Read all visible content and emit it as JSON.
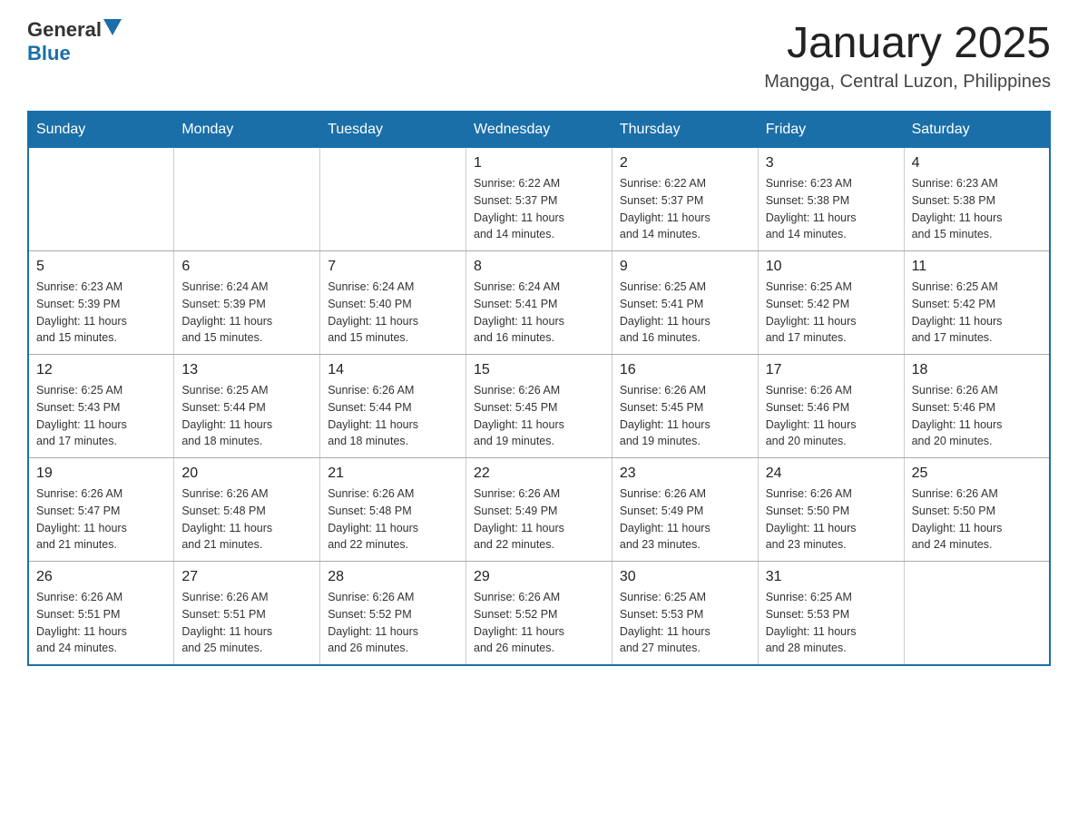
{
  "header": {
    "logo_general": "General",
    "logo_blue": "Blue",
    "month_title": "January 2025",
    "location": "Mangga, Central Luzon, Philippines"
  },
  "days_of_week": [
    "Sunday",
    "Monday",
    "Tuesday",
    "Wednesday",
    "Thursday",
    "Friday",
    "Saturday"
  ],
  "weeks": [
    [
      {
        "day": "",
        "info": ""
      },
      {
        "day": "",
        "info": ""
      },
      {
        "day": "",
        "info": ""
      },
      {
        "day": "1",
        "info": "Sunrise: 6:22 AM\nSunset: 5:37 PM\nDaylight: 11 hours\nand 14 minutes."
      },
      {
        "day": "2",
        "info": "Sunrise: 6:22 AM\nSunset: 5:37 PM\nDaylight: 11 hours\nand 14 minutes."
      },
      {
        "day": "3",
        "info": "Sunrise: 6:23 AM\nSunset: 5:38 PM\nDaylight: 11 hours\nand 14 minutes."
      },
      {
        "day": "4",
        "info": "Sunrise: 6:23 AM\nSunset: 5:38 PM\nDaylight: 11 hours\nand 15 minutes."
      }
    ],
    [
      {
        "day": "5",
        "info": "Sunrise: 6:23 AM\nSunset: 5:39 PM\nDaylight: 11 hours\nand 15 minutes."
      },
      {
        "day": "6",
        "info": "Sunrise: 6:24 AM\nSunset: 5:39 PM\nDaylight: 11 hours\nand 15 minutes."
      },
      {
        "day": "7",
        "info": "Sunrise: 6:24 AM\nSunset: 5:40 PM\nDaylight: 11 hours\nand 15 minutes."
      },
      {
        "day": "8",
        "info": "Sunrise: 6:24 AM\nSunset: 5:41 PM\nDaylight: 11 hours\nand 16 minutes."
      },
      {
        "day": "9",
        "info": "Sunrise: 6:25 AM\nSunset: 5:41 PM\nDaylight: 11 hours\nand 16 minutes."
      },
      {
        "day": "10",
        "info": "Sunrise: 6:25 AM\nSunset: 5:42 PM\nDaylight: 11 hours\nand 17 minutes."
      },
      {
        "day": "11",
        "info": "Sunrise: 6:25 AM\nSunset: 5:42 PM\nDaylight: 11 hours\nand 17 minutes."
      }
    ],
    [
      {
        "day": "12",
        "info": "Sunrise: 6:25 AM\nSunset: 5:43 PM\nDaylight: 11 hours\nand 17 minutes."
      },
      {
        "day": "13",
        "info": "Sunrise: 6:25 AM\nSunset: 5:44 PM\nDaylight: 11 hours\nand 18 minutes."
      },
      {
        "day": "14",
        "info": "Sunrise: 6:26 AM\nSunset: 5:44 PM\nDaylight: 11 hours\nand 18 minutes."
      },
      {
        "day": "15",
        "info": "Sunrise: 6:26 AM\nSunset: 5:45 PM\nDaylight: 11 hours\nand 19 minutes."
      },
      {
        "day": "16",
        "info": "Sunrise: 6:26 AM\nSunset: 5:45 PM\nDaylight: 11 hours\nand 19 minutes."
      },
      {
        "day": "17",
        "info": "Sunrise: 6:26 AM\nSunset: 5:46 PM\nDaylight: 11 hours\nand 20 minutes."
      },
      {
        "day": "18",
        "info": "Sunrise: 6:26 AM\nSunset: 5:46 PM\nDaylight: 11 hours\nand 20 minutes."
      }
    ],
    [
      {
        "day": "19",
        "info": "Sunrise: 6:26 AM\nSunset: 5:47 PM\nDaylight: 11 hours\nand 21 minutes."
      },
      {
        "day": "20",
        "info": "Sunrise: 6:26 AM\nSunset: 5:48 PM\nDaylight: 11 hours\nand 21 minutes."
      },
      {
        "day": "21",
        "info": "Sunrise: 6:26 AM\nSunset: 5:48 PM\nDaylight: 11 hours\nand 22 minutes."
      },
      {
        "day": "22",
        "info": "Sunrise: 6:26 AM\nSunset: 5:49 PM\nDaylight: 11 hours\nand 22 minutes."
      },
      {
        "day": "23",
        "info": "Sunrise: 6:26 AM\nSunset: 5:49 PM\nDaylight: 11 hours\nand 23 minutes."
      },
      {
        "day": "24",
        "info": "Sunrise: 6:26 AM\nSunset: 5:50 PM\nDaylight: 11 hours\nand 23 minutes."
      },
      {
        "day": "25",
        "info": "Sunrise: 6:26 AM\nSunset: 5:50 PM\nDaylight: 11 hours\nand 24 minutes."
      }
    ],
    [
      {
        "day": "26",
        "info": "Sunrise: 6:26 AM\nSunset: 5:51 PM\nDaylight: 11 hours\nand 24 minutes."
      },
      {
        "day": "27",
        "info": "Sunrise: 6:26 AM\nSunset: 5:51 PM\nDaylight: 11 hours\nand 25 minutes."
      },
      {
        "day": "28",
        "info": "Sunrise: 6:26 AM\nSunset: 5:52 PM\nDaylight: 11 hours\nand 26 minutes."
      },
      {
        "day": "29",
        "info": "Sunrise: 6:26 AM\nSunset: 5:52 PM\nDaylight: 11 hours\nand 26 minutes."
      },
      {
        "day": "30",
        "info": "Sunrise: 6:25 AM\nSunset: 5:53 PM\nDaylight: 11 hours\nand 27 minutes."
      },
      {
        "day": "31",
        "info": "Sunrise: 6:25 AM\nSunset: 5:53 PM\nDaylight: 11 hours\nand 28 minutes."
      },
      {
        "day": "",
        "info": ""
      }
    ]
  ]
}
